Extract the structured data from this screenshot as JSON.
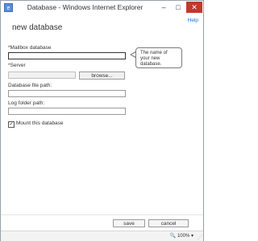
{
  "window": {
    "title": "Database - Windows Internet Explorer",
    "controls": {
      "minimize": "–",
      "maximize": "□",
      "close": "✕"
    }
  },
  "header": {
    "help": "Help",
    "title": "new database"
  },
  "form": {
    "mailbox_label": "*Mailbox database",
    "mailbox_value": "",
    "server_label": "*Server",
    "server_value": "",
    "browse_label": "browse...",
    "db_path_label": "Database file path:",
    "db_path_value": "",
    "log_path_label": "Log folder path:",
    "log_path_value": "",
    "mount_label": "Mount this database",
    "mount_checked": true
  },
  "tooltip": {
    "text": "The name of your new database."
  },
  "footer": {
    "save": "save",
    "cancel": "cancel"
  },
  "status": {
    "zoom": "🔍 100%  ▾"
  },
  "icons": {
    "checkbox": "checkmark-icon",
    "app": "ie-app-icon"
  },
  "colors": {
    "close_button": "#c0392b",
    "link": "#1b6ac9"
  }
}
